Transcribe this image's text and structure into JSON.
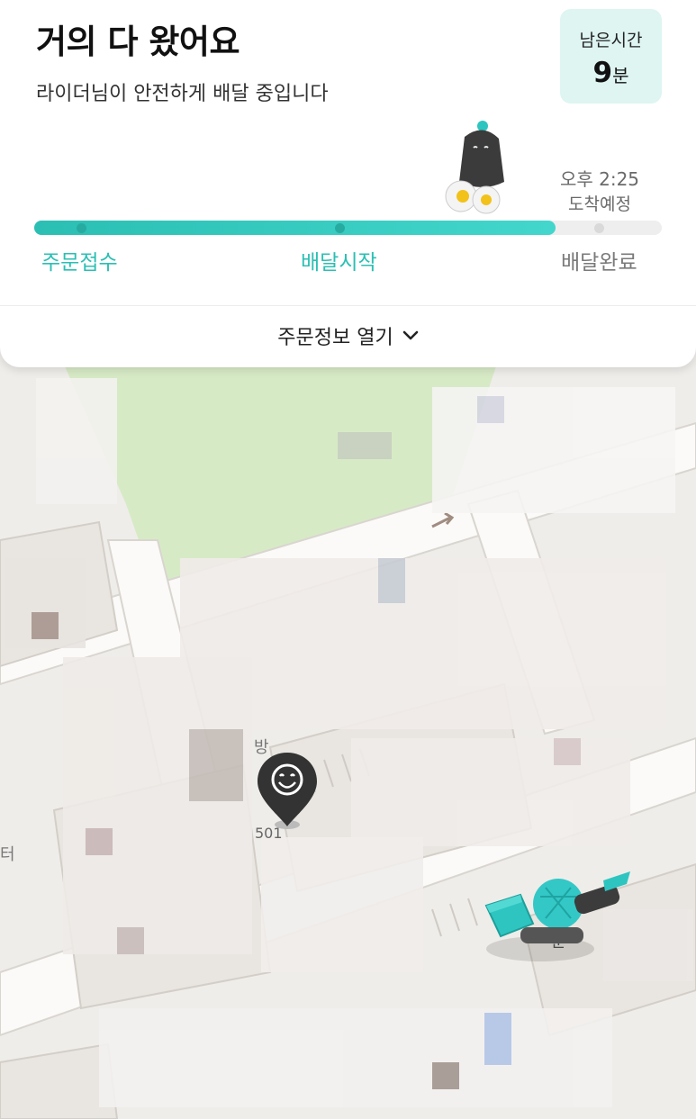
{
  "status": {
    "title": "거의 다 왔어요",
    "subtitle": "라이더님이 안전하게 배달 중입니다"
  },
  "remaining": {
    "label": "남은시간",
    "minutes": "9",
    "unit": "분"
  },
  "eta": {
    "time": "오후 2:25",
    "label": "도착예정"
  },
  "progress": {
    "fraction": 0.83,
    "steps": [
      {
        "label": "주문접수",
        "done": true
      },
      {
        "label": "배달시작",
        "done": true
      },
      {
        "label": "배달완료",
        "done": false
      }
    ]
  },
  "order_toggle": {
    "label": "주문정보 열기"
  },
  "map": {
    "address_number": "501",
    "labels": [
      "방",
      "분",
      "터"
    ]
  },
  "colors": {
    "accent": "#2bbfb4",
    "accent_light": "#def5f2",
    "park": "#d8ebc7",
    "map_bg": "#efedea",
    "pin": "#333333"
  },
  "icons": {
    "chevron": "chevron-down-icon",
    "destination": "destination-pin-icon",
    "rider": "rider-scooter-icon"
  }
}
